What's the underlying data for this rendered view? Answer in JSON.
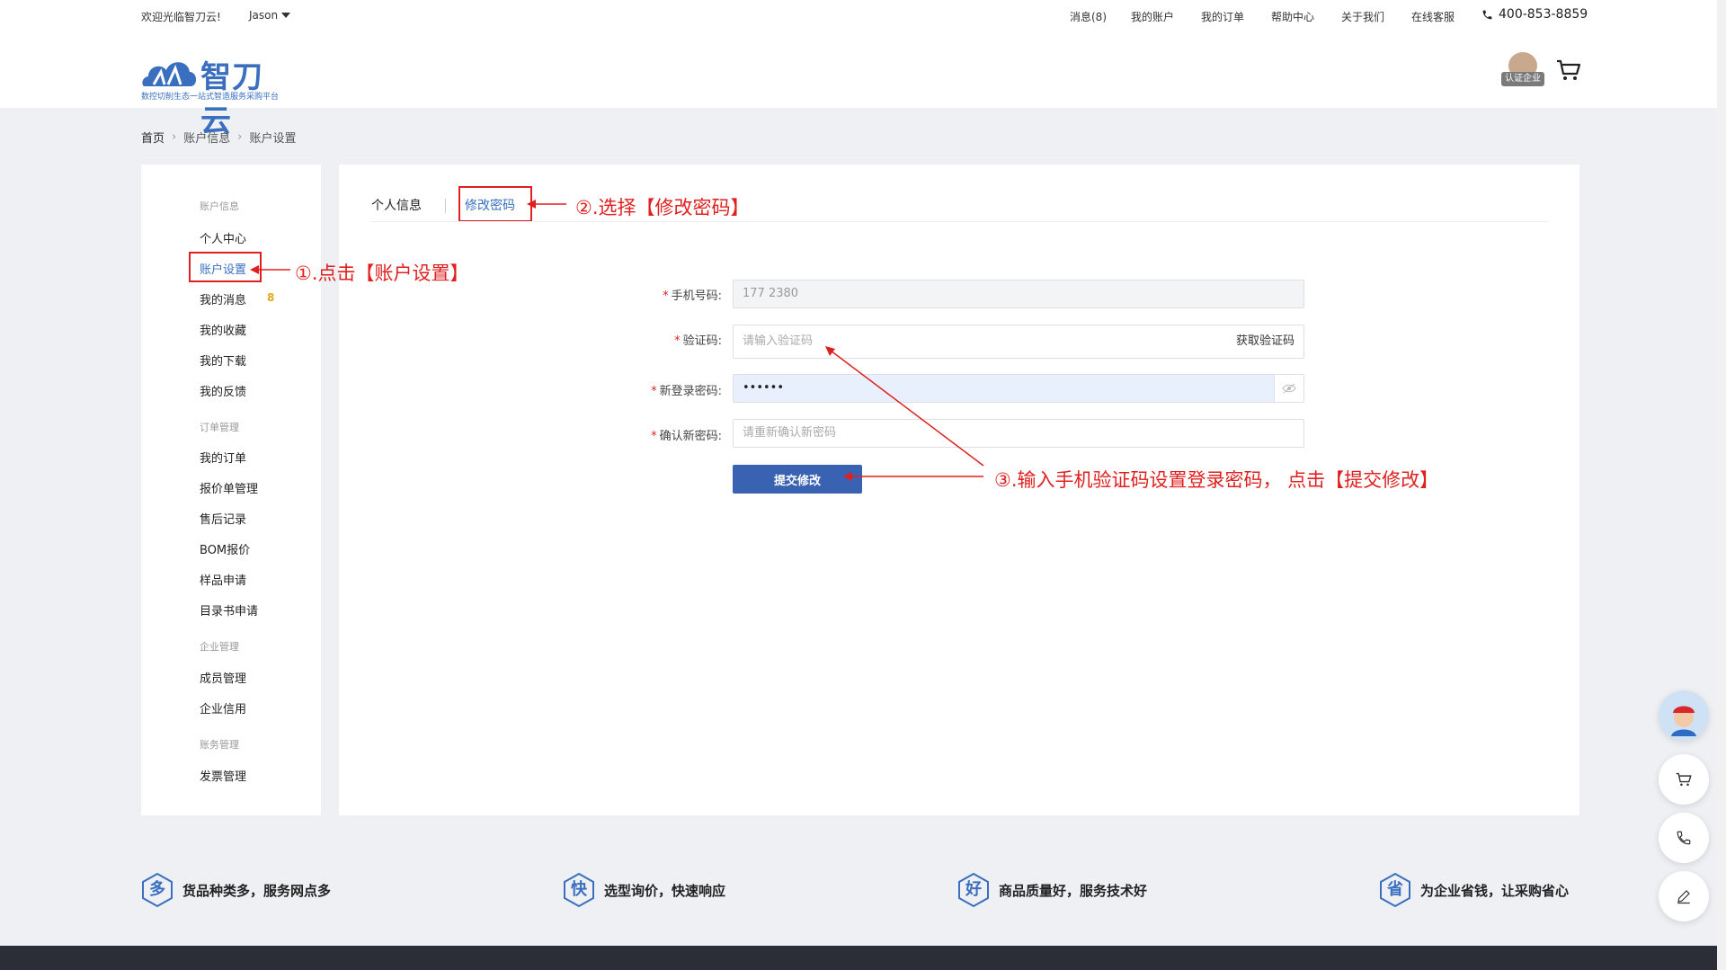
{
  "header": {
    "welcome": "欢迎光临智刀云!",
    "user": "Jason",
    "nav": [
      "消息(8)",
      "我的账户",
      "我的订单",
      "帮助中心",
      "关于我们",
      "在线客服"
    ],
    "phone": "400-853-8859",
    "logo_text": "智刀云",
    "logo_sub": "数控切削生态一站式智造服务采购平台",
    "badge": "认证企业"
  },
  "breadcrumb": [
    "首页",
    "账户信息",
    "账户设置"
  ],
  "sidebar": {
    "groups": [
      {
        "title": "账户信息",
        "items": [
          "个人中心",
          "账户设置",
          "我的消息",
          "我的收藏",
          "我的下载",
          "我的反馈"
        ]
      },
      {
        "title": "订单管理",
        "items": [
          "我的订单",
          "报价单管理",
          "售后记录",
          "BOM报价",
          "样品申请",
          "目录书申请"
        ]
      },
      {
        "title": "企业管理",
        "items": [
          "成员管理",
          "企业信用"
        ]
      },
      {
        "title": "账务管理",
        "items": [
          "发票管理"
        ]
      }
    ],
    "message_badge": "8"
  },
  "tabs": [
    "个人信息",
    "修改密码"
  ],
  "form": {
    "phone_label": "手机号码:",
    "phone_value": "177 2380",
    "code_label": "验证码:",
    "code_placeholder": "请输入验证码",
    "get_code": "获取验证码",
    "new_pwd_label": "新登录密码:",
    "new_pwd_value": "••••••",
    "confirm_label": "确认新密码:",
    "confirm_placeholder": "请重新确认新密码",
    "submit": "提交修改"
  },
  "annotations": {
    "step1": "①.点击【账户设置】",
    "step2": "②.选择【修改密码】",
    "step3": "③.输入手机验证码设置登录密码， 点击【提交修改】"
  },
  "features": [
    {
      "icon": "多",
      "text": "货品种类多，服务网点多"
    },
    {
      "icon": "快",
      "text": "选型询价，快速响应"
    },
    {
      "icon": "好",
      "text": "商品质量好，服务技术好"
    },
    {
      "icon": "省",
      "text": "为企业省钱，让采购省心"
    }
  ],
  "colors": {
    "accent": "#3a6fc0",
    "annotation": "#e02020",
    "button": "#3a62b3"
  }
}
